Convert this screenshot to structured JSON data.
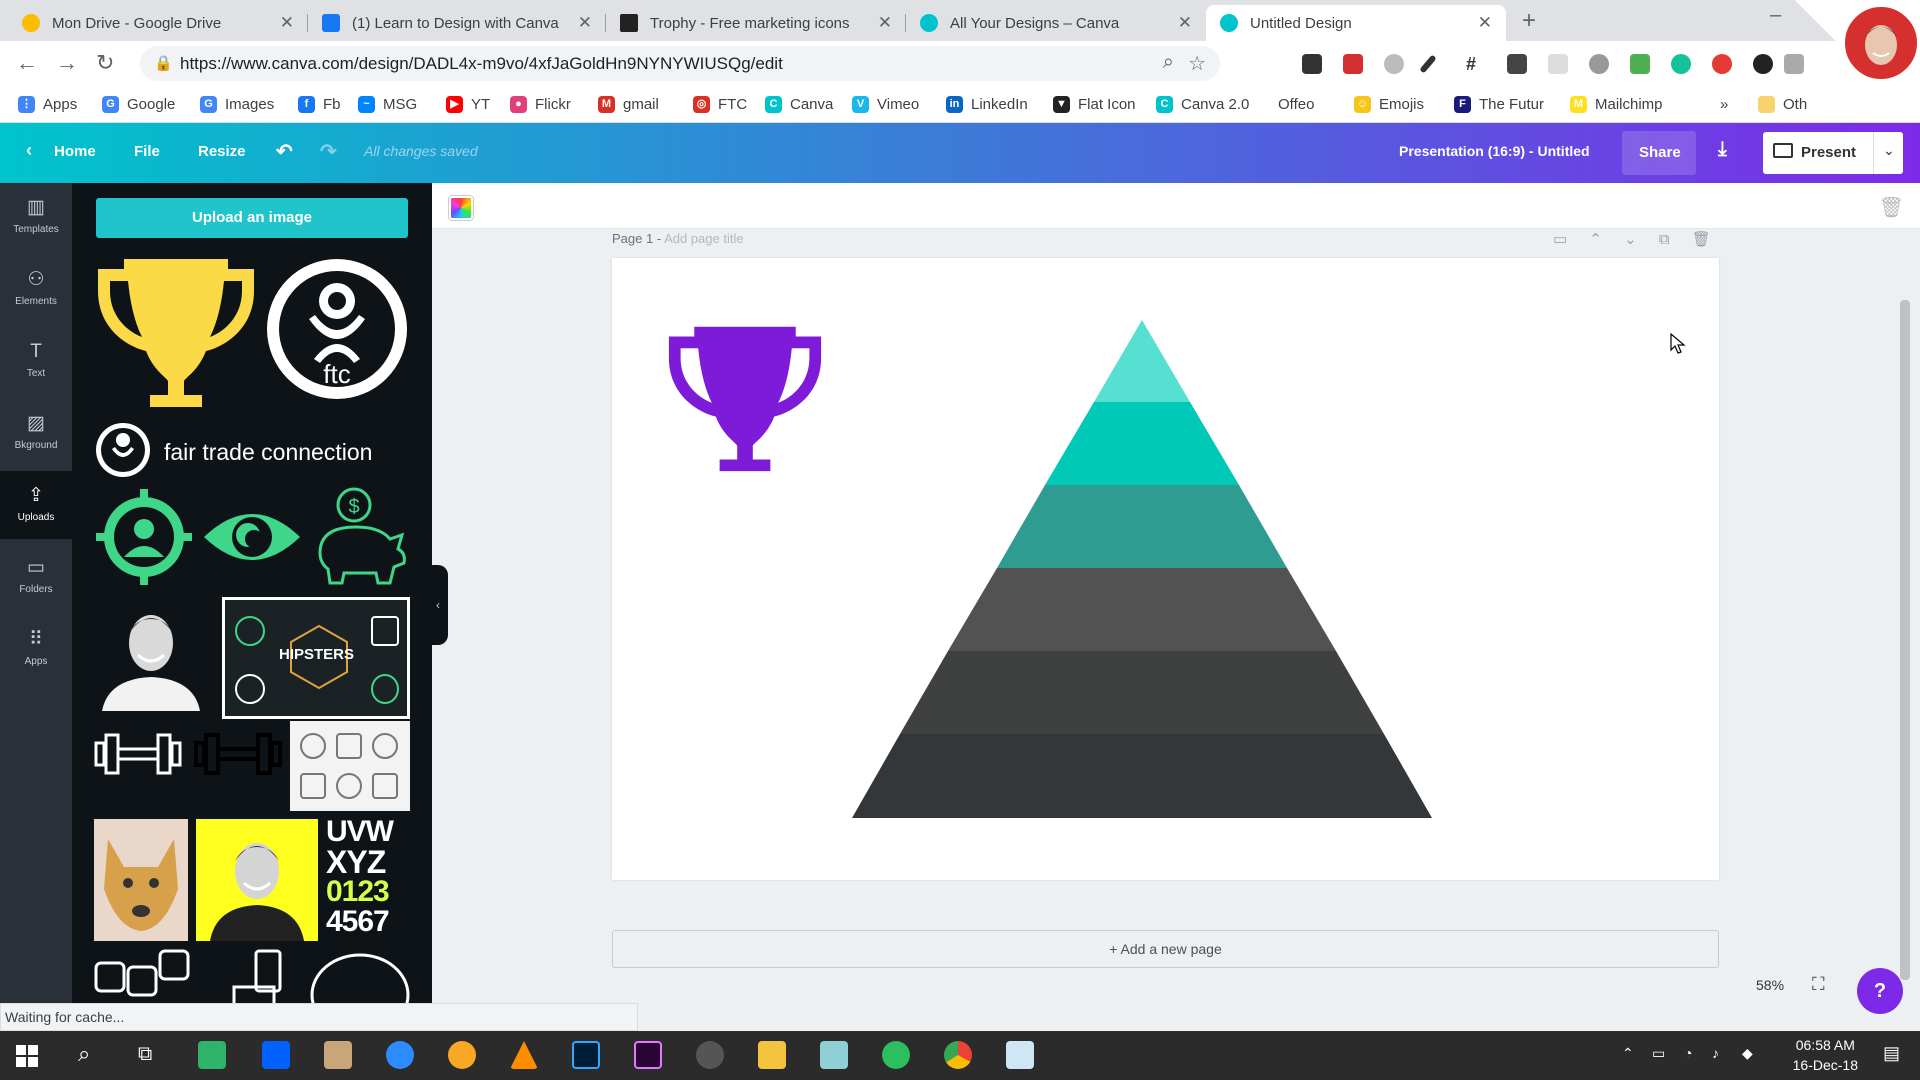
{
  "browser": {
    "tabs": [
      {
        "title": "Mon Drive - Google Drive",
        "color": "#fbbc04"
      },
      {
        "title": "(1) Learn to Design with Canva",
        "color": "#1877f2"
      },
      {
        "title": "Trophy - Free marketing icons",
        "color": "#222222"
      },
      {
        "title": "All Your Designs – Canva",
        "color": "#00c4cc"
      },
      {
        "title": "Untitled Design",
        "color": "#00c4cc"
      }
    ],
    "new_tab": "+",
    "close_glyph": "✕",
    "url": "https://www.canva.com/design/DADL4x-m9vo/4xfJaGoldHn9NYNYWIUSQg/edit",
    "bookmarks": [
      {
        "label": "Apps",
        "color": "#4285f4",
        "glyph": "⋮"
      },
      {
        "label": "Google",
        "color": "#4285f4",
        "glyph": "G"
      },
      {
        "label": "Images",
        "color": "#4285f4",
        "glyph": "G"
      },
      {
        "label": "Fb",
        "color": "#1877f2",
        "glyph": "f"
      },
      {
        "label": "MSG",
        "color": "#0084ff",
        "glyph": "~"
      },
      {
        "label": "YT",
        "color": "#ff0000",
        "glyph": "▶"
      },
      {
        "label": "Flickr",
        "color": "#e0407a",
        "glyph": "●"
      },
      {
        "label": "gmail",
        "color": "#d93025",
        "glyph": "M"
      },
      {
        "label": "FTC",
        "color": "#d93025",
        "glyph": "◎"
      },
      {
        "label": "Canva",
        "color": "#00c4cc",
        "glyph": "C"
      },
      {
        "label": "Vimeo",
        "color": "#1ab7ea",
        "glyph": "V"
      },
      {
        "label": "LinkedIn",
        "color": "#0a66c2",
        "glyph": "in"
      },
      {
        "label": "Flat Icon",
        "color": "#222222",
        "glyph": "▼"
      },
      {
        "label": "Canva 2.0",
        "color": "#00c4cc",
        "glyph": "C"
      },
      {
        "label": "Offeo",
        "color": "#ffffff",
        "glyph": ""
      },
      {
        "label": "Emojis",
        "color": "#f5c518",
        "glyph": "☺"
      },
      {
        "label": "The Futur",
        "color": "#1a1a7a",
        "glyph": "F"
      },
      {
        "label": "Mailchimp",
        "color": "#ffe01b",
        "glyph": "M"
      },
      {
        "label": "Oth",
        "color": "#f7d36b",
        "glyph": ""
      }
    ],
    "bookmarks_more": "»"
  },
  "editor": {
    "home": "Home",
    "file": "File",
    "resize": "Resize",
    "saved_status": "All changes saved",
    "doc_title": "Presentation (16:9) - Untitled",
    "share": "Share",
    "present": "Present",
    "brand_gradient": [
      "#00c4cc",
      "#7d2ae8"
    ]
  },
  "sidebar": [
    {
      "label": "Templates",
      "icon": "templates-icon",
      "glyph": "▥"
    },
    {
      "label": "Elements",
      "icon": "elements-icon",
      "glyph": "⚇"
    },
    {
      "label": "Text",
      "icon": "text-icon",
      "glyph": "T"
    },
    {
      "label": "Bkground",
      "icon": "background-icon",
      "glyph": "▨"
    },
    {
      "label": "Uploads",
      "icon": "uploads-icon",
      "glyph": "⇪"
    },
    {
      "label": "Folders",
      "icon": "folder-icon",
      "glyph": "▭"
    },
    {
      "label": "Apps",
      "icon": "apps-grid-icon",
      "glyph": "⠿"
    }
  ],
  "uploads": {
    "button": "Upload an image",
    "ftc_mark": "ftc",
    "logo_text": "fair trade connection",
    "hipsters_text": "HIPSTERS",
    "font_sample": [
      "UVW",
      "XYZ",
      "0123",
      "4567"
    ],
    "dollar": "$"
  },
  "canvas": {
    "page_label": "Page 1 -",
    "page_title_placeholder": "Add page title",
    "add_page": "+ Add a new page",
    "zoom": "58%",
    "help": "?",
    "trophy_color": "#7d1bd8",
    "pyramid_colors": [
      "#55e0d2",
      "#00c9b7",
      "#2e9c90",
      "#525252",
      "#3f4040",
      "#343739"
    ]
  },
  "status_bar": "Waiting for cache...",
  "taskbar": {
    "time": "06:58 AM",
    "date": "16-Dec-18"
  }
}
